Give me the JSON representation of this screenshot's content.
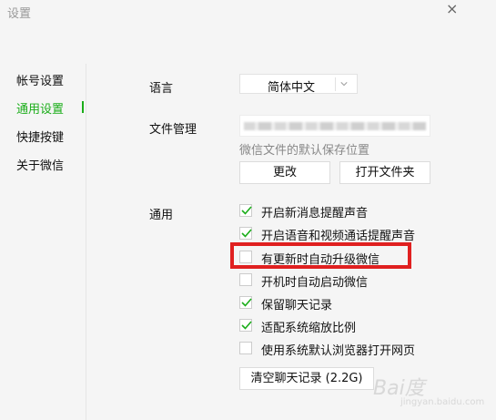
{
  "window": {
    "title": "设置",
    "close_glyph": "×"
  },
  "sidebar": {
    "items": [
      {
        "label": "帐号设置",
        "active": false
      },
      {
        "label": "通用设置",
        "active": true
      },
      {
        "label": "快捷按键",
        "active": false
      },
      {
        "label": "关于微信",
        "active": false
      }
    ]
  },
  "language": {
    "label": "语言",
    "value": "简体中文"
  },
  "file_management": {
    "label": "文件管理",
    "hint": "微信文件的默认保存位置",
    "change_button": "更改",
    "open_folder_button": "打开文件夹"
  },
  "general": {
    "label": "通用",
    "options": [
      {
        "label": "开启新消息提醒声音",
        "checked": true
      },
      {
        "label": "开启语音和视频通话提醒声音",
        "checked": true
      },
      {
        "label": "有更新时自动升级微信",
        "checked": false
      },
      {
        "label": "开机时自动启动微信",
        "checked": false
      },
      {
        "label": "保留聊天记录",
        "checked": true
      },
      {
        "label": "适配系统缩放比例",
        "checked": true
      },
      {
        "label": "使用系统默认浏览器打开网页",
        "checked": false
      }
    ],
    "clear_history_button": "清空聊天记录 (2.2G)"
  },
  "colors": {
    "accent": "#1aad19",
    "highlight": "#e02020"
  },
  "watermark": {
    "text": "Bai度",
    "sub": "jingyan.baidu.com"
  }
}
